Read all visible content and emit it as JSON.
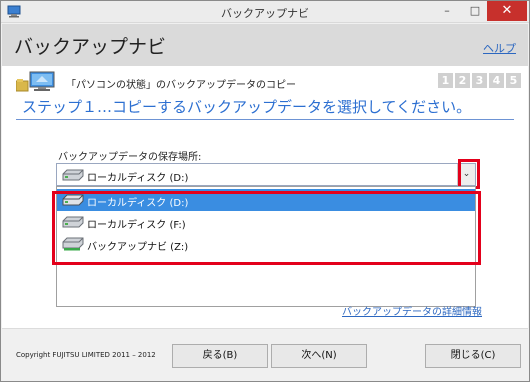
{
  "window": {
    "title": "バックアップナビ",
    "controls": {
      "minimize": "–",
      "maximize": "□",
      "close": "✕"
    }
  },
  "header": {
    "app_title": "バックアップナビ",
    "help_link": "ヘルプ"
  },
  "crumb": {
    "text": "「パソコンの状態」のバックアップデータのコピー",
    "icon": "computer-backup-icon"
  },
  "steps": {
    "items": [
      "1",
      "2",
      "3",
      "4",
      "5"
    ],
    "current": "1"
  },
  "step_title": "ステップ１…コピーするバックアップデータを選択してください。",
  "location": {
    "label": "バックアップデータの保存場所:",
    "selected_value": "ローカルディスク (D:)",
    "arrow": "⌄",
    "options": [
      {
        "label": "ローカルディスク (D:)",
        "icon": "local-disk-icon"
      },
      {
        "label": "ローカルディスク (F:)",
        "icon": "local-disk-icon"
      },
      {
        "label": "バックアップナビ (Z:)",
        "icon": "network-drive-icon"
      }
    ]
  },
  "detail_link": "バックアップデータの詳細情報",
  "footer": {
    "copyright": "Copyright FUJITSU LIMITED 2011 – 2012",
    "back": "戻る(B)",
    "next": "次へ(N)",
    "close": "閉じる(C)"
  },
  "colors": {
    "accent": "#2c6fd1",
    "selection": "#3a8de1",
    "highlight_frame": "#e3001b",
    "close_button": "#c7302c"
  }
}
